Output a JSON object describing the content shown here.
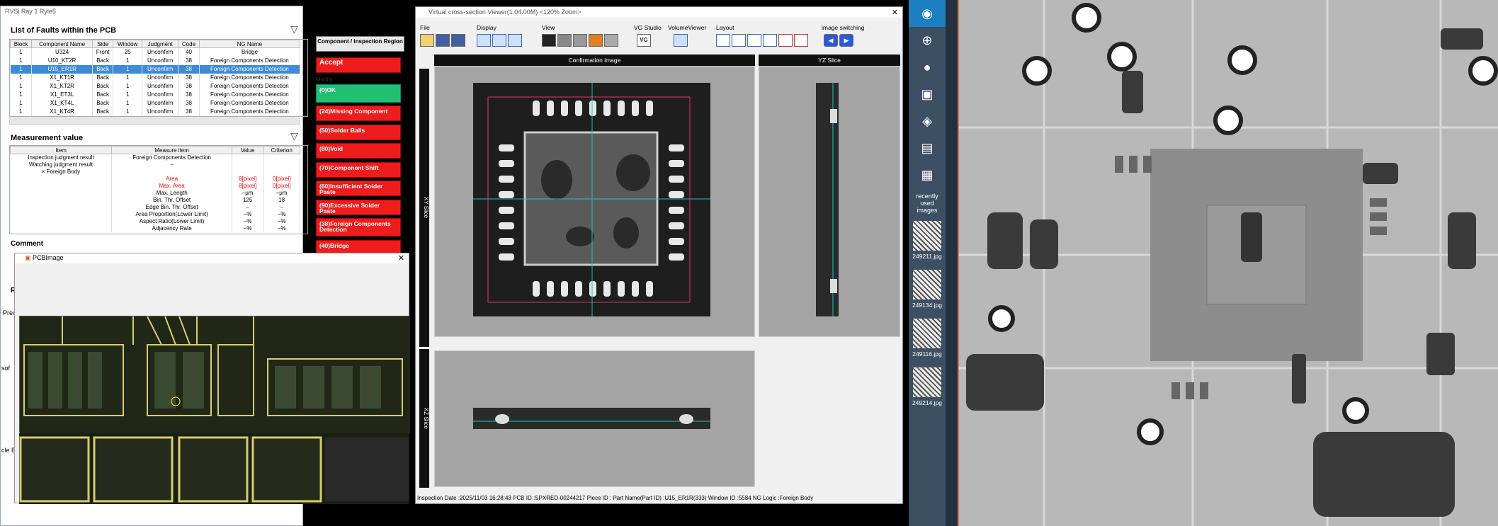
{
  "left_window": {
    "title": "RVSi Ray 1 Ryle5",
    "faults_title": "List of Faults within the PCB",
    "fault_columns": [
      "Block",
      "Component Name",
      "Side",
      "Window",
      "Judgment",
      "Code",
      "NG Name"
    ],
    "faults": [
      [
        "1",
        "U324",
        "Front",
        "25",
        "Unconfirm",
        "40",
        "Bridge"
      ],
      [
        "1",
        "U10_KT2R",
        "Back",
        "1",
        "Unconfirm",
        "38",
        "Foreign Components Detection"
      ],
      [
        "1",
        "U15_ER1R",
        "Back",
        "1",
        "Unconfirm",
        "38",
        "Foreign Components Detection"
      ],
      [
        "1",
        "X1_KT1R",
        "Back",
        "1",
        "Unconfirm",
        "38",
        "Foreign Components Detection"
      ],
      [
        "1",
        "X1_KT2R",
        "Back",
        "1",
        "Unconfirm",
        "38",
        "Foreign Components Detection"
      ],
      [
        "1",
        "X1_ET3L",
        "Back",
        "1",
        "Unconfirm",
        "38",
        "Foreign Components Detection"
      ],
      [
        "1",
        "X1_KT4L",
        "Back",
        "1",
        "Unconfirm",
        "38",
        "Foreign Components Detection"
      ],
      [
        "1",
        "X1_KT4R",
        "Back",
        "1",
        "Unconfirm",
        "38",
        "Foreign Components Detection"
      ]
    ],
    "selected_fault_index": 2,
    "measurement_title": "Measurement value",
    "measure_columns": [
      "Item",
      "Measure item",
      "Value",
      "Criterion"
    ],
    "measures": [
      {
        "item": "Inspection judgment result",
        "measure": "Foreign Components Detection",
        "value": "",
        "criterion": "",
        "red": false
      },
      {
        "item": "Watching judgment result",
        "measure": "–",
        "value": "",
        "criterion": "",
        "red": false
      },
      {
        "item": "× Foreign Body",
        "measure": "",
        "value": "",
        "criterion": "",
        "red": false
      },
      {
        "item": "",
        "measure": "Area",
        "value": "8[pixel]",
        "criterion": "0[pixel]",
        "red": true
      },
      {
        "item": "",
        "measure": "Max. Area",
        "value": "8[pixel]",
        "criterion": "0[pixel]",
        "red": true
      },
      {
        "item": "",
        "measure": "Max. Length",
        "value": "–μm",
        "criterion": "–μm",
        "red": false
      },
      {
        "item": "",
        "measure": "Bin. Thr. Offset",
        "value": "125",
        "criterion": "18",
        "red": false
      },
      {
        "item": "",
        "measure": "Edge Bin. Thr. Offset",
        "value": "–",
        "criterion": "–",
        "red": false
      },
      {
        "item": "",
        "measure": "Area Proportion(Lower Limit)",
        "value": "–%",
        "criterion": "–%",
        "red": false
      },
      {
        "item": "",
        "measure": "Aspect Ratio(Lower Limit)",
        "value": "–%",
        "criterion": "–%",
        "red": false
      },
      {
        "item": "",
        "measure": "Adjacency Rate",
        "value": "–%",
        "criterion": "–%",
        "red": false
      }
    ],
    "comment_label": "Comment",
    "rv_label": "RV",
    "prev_label": "Prev",
    "side_label_1": "sof",
    "side_label_2": "cle B",
    "component_header": "Component / Inspection Region",
    "accept_label": "Accept",
    "modify_label": "Modify",
    "ok_label": "(0)OK",
    "ng_buttons": [
      "(24)Missing Component",
      "(50)Solder Balls",
      "(80)Void",
      "(70)Component Shift",
      "(60)Insufficient Solder Paste",
      "(90)Excessive Solder Paste",
      "(38)Foreign Components Detection",
      "(40)Bridge"
    ]
  },
  "pcb_window": {
    "title": "PCBImage",
    "close": "✕"
  },
  "viewer": {
    "title": "Virtual cross-section Viewer(1.04.00M)  <120% Zoom>",
    "close": "✕",
    "groups": [
      "File",
      "Display",
      "View",
      "VG Studio",
      "VolumeViewer",
      "Layout",
      "image switching"
    ],
    "vg_label": "VG",
    "confirmation_label": "Confirmation image",
    "yz_label": "YZ Slice",
    "xy_label": "XY Slice",
    "xz_label": "XZ Slice",
    "status": "Inspection Date :2025/11/03 16:28:43  PCB ID :SPXRED-00244217  Piece ID :  Part Name(Part ID) :U15_ER1R(333)  Window ID :5584  NG Logic :Foreign Body"
  },
  "sidebar": {
    "icons": [
      "zoom-fit-icon",
      "zoom-in-icon",
      "palette-icon",
      "cube-icon",
      "camera-icon",
      "document-icon",
      "map-icon"
    ],
    "recent_label": "recently used images",
    "recent": [
      "249211.jpg",
      "249134.jpg",
      "249116.jpg",
      "249214.jpg"
    ]
  },
  "colors": {
    "accent_blue": "#3d8bd8",
    "ng_red": "#ee1c1c",
    "ok_green": "#20c070",
    "sidebar": "#3c4f63"
  }
}
